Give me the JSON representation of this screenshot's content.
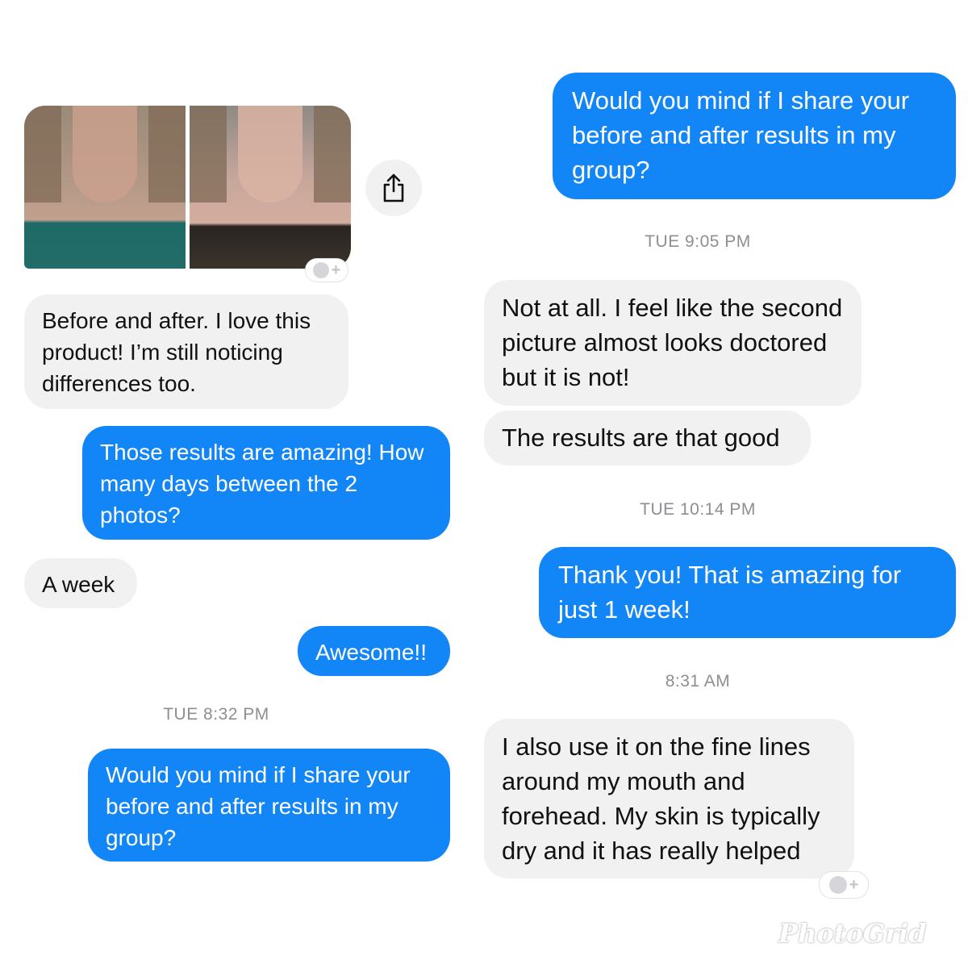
{
  "left_panel": {
    "message_1": "Before and after. I love this product! I’m still noticing differences too.",
    "message_2": "Those results are amazing! How many days between the 2 photos?",
    "message_3": "A week",
    "message_4": "Awesome!!",
    "timestamp_1": "TUE 8:32 PM",
    "message_5": "Would you mind if I share your before and after results in my group?"
  },
  "right_panel": {
    "message_1": "Would you mind if I share your before and after results in my group?",
    "timestamp_1": "TUE 9:05 PM",
    "message_2": "Not at all. I feel like the second picture almost looks doctored but it is not!",
    "message_3": "The results are that good",
    "timestamp_2": "TUE 10:14 PM",
    "message_4": "Thank you!  That is amazing for just 1 week!",
    "timestamp_3": "8:31 AM",
    "message_5": "I also use it on the fine lines around my mouth and forehead. My skin is typically dry and it has really helped"
  },
  "reaction_plus": "+",
  "watermark": "PhotoGrid",
  "colors": {
    "outgoing": "#1386f7",
    "incoming": "#f1f1f2",
    "timestamp": "#8e8e93"
  },
  "icons": [
    "share-icon",
    "add-reaction-icon"
  ]
}
